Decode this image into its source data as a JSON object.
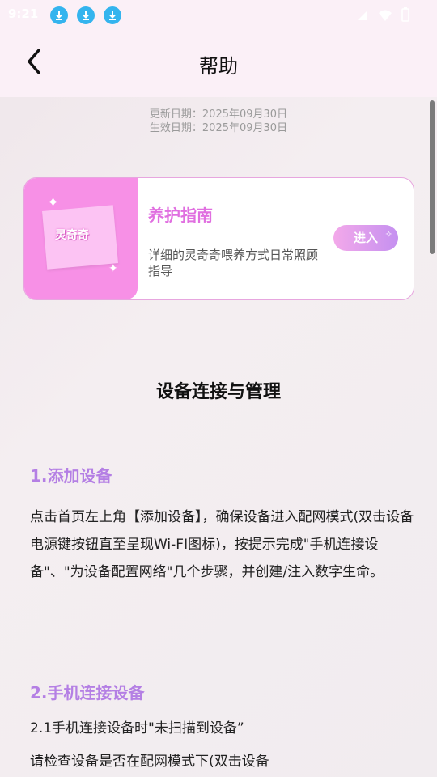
{
  "status_bar": {
    "time": "9:21"
  },
  "header": {
    "title": "帮助"
  },
  "dates": {
    "updated": "更新日期：2025年09月30日",
    "effective": "生效日期：2025年09月30日"
  },
  "card": {
    "image_logo": "灵奇奇",
    "title": "养护指南",
    "description": "详细的灵奇奇喂养方式日常照顾指导",
    "button": "进入"
  },
  "section": {
    "title": "设备连接与管理",
    "h1": "1.添加设备",
    "p1": "点击首页左上角【添加设备】，确保设备进入配网模式(双击设备电源键按钮直至呈现Wi-FI图标)，按提示完成\"手机连接设备\"、\"为设备配置网络\"几个步骤，并创建/注入数字生命。",
    "h2": "2.手机连接设备",
    "h2_1": "2.1手机连接设备时\"未扫描到设备”",
    "p2": "请检查设备是否在配网模式下(双击设备"
  },
  "colors": {
    "accent": "#b47fe4",
    "card_pink": "#f790e6",
    "title_pink": "#e06fe0"
  },
  "icons": [
    "download-icon",
    "back-icon",
    "wifi-icon",
    "battery-icon"
  ]
}
